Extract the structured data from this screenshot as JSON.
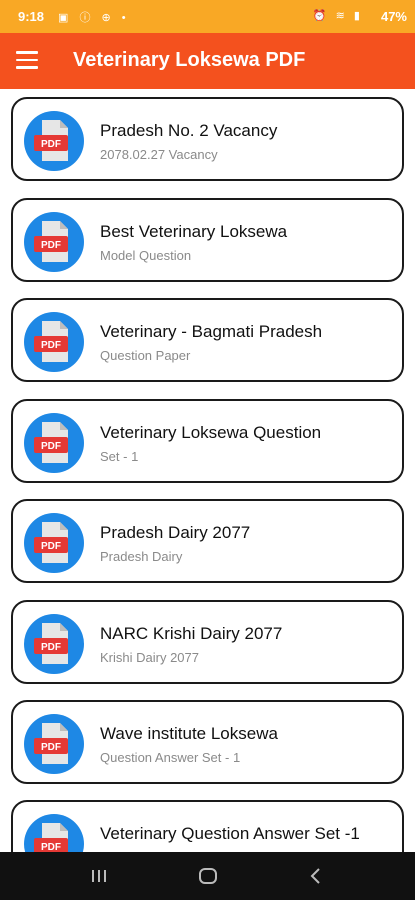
{
  "status": {
    "time": "9:18",
    "battery": "47%"
  },
  "appbar": {
    "title": "Veterinary Loksewa PDF"
  },
  "colors": {
    "status": "#F9A825",
    "appbar": "#F4511E",
    "pdf_circle": "#1E88E5",
    "pdf_label": "#E53935"
  },
  "icons": {
    "menu": "hamburger-menu-icon",
    "pdf": "pdf-file-icon",
    "back": "back-icon",
    "home": "home-icon",
    "recent": "recent-apps-icon"
  },
  "items": [
    {
      "title": "Pradesh No. 2 Vacancy",
      "subtitle": "2078.02.27 Vacancy",
      "badge": "PDF"
    },
    {
      "title": "Best Veterinary Loksewa",
      "subtitle": "Model Question",
      "badge": "PDF"
    },
    {
      "title": "Veterinary - Bagmati Pradesh",
      "subtitle": "Question Paper",
      "badge": "PDF"
    },
    {
      "title": "Veterinary Loksewa Question",
      "subtitle": "Set - 1",
      "badge": "PDF"
    },
    {
      "title": "Pradesh Dairy 2077",
      "subtitle": "Pradesh Dairy",
      "badge": "PDF"
    },
    {
      "title": "NARC Krishi Dairy 2077",
      "subtitle": "Krishi Dairy 2077",
      "badge": "PDF"
    },
    {
      "title": "Wave institute Loksewa",
      "subtitle": "Question Answer Set - 1",
      "badge": "PDF"
    },
    {
      "title": "Veterinary Question Answer Set -1",
      "subtitle": "",
      "badge": "PDF"
    }
  ]
}
